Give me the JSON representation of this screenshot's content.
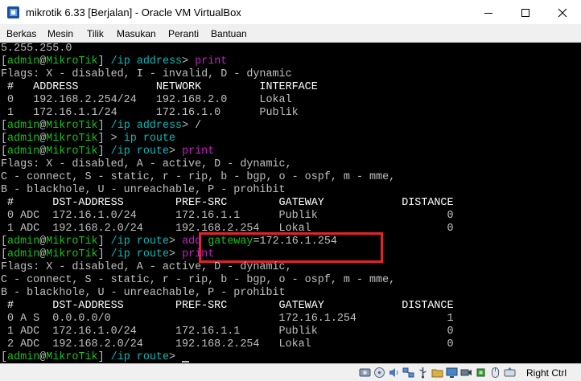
{
  "window": {
    "title": "mikrotik 6.33 [Berjalan] - Oracle VM VirtualBox",
    "icons": [
      "virtualbox-icon",
      "minimize-icon",
      "maximize-icon",
      "close-icon"
    ]
  },
  "menu": {
    "items": [
      "Berkas",
      "Mesin",
      "Tilik",
      "Masukan",
      "Peranti",
      "Bantuan"
    ]
  },
  "terminal": {
    "colors": {
      "background": "#000000",
      "default": "#c0c0c0",
      "green": "#19c219",
      "teal": "#0bb8b8",
      "purple": "#c020c0",
      "highlight_box": "#e0242a"
    },
    "lines": [
      [
        [
          "5.255.255.0",
          "d"
        ]
      ],
      [
        [
          "[",
          "d"
        ],
        [
          "admin",
          "g"
        ],
        [
          "@",
          "d"
        ],
        [
          "MikroTik",
          "g"
        ],
        [
          "] ",
          "d"
        ],
        [
          "/ip address",
          "t"
        ],
        [
          "> ",
          "d"
        ],
        [
          "print",
          "p"
        ]
      ],
      [
        [
          "Flags: X - disabled, I - invalid, D - dynamic",
          "d"
        ]
      ],
      [
        [
          " #   ADDRESS            NETWORK         INTERFACE",
          "w"
        ]
      ],
      [
        [
          " 0   192.168.2.254/24   192.168.2.0     Lokal",
          "d"
        ]
      ],
      [
        [
          " 1   172.16.1.1/24      172.16.1.0      Publik",
          "d"
        ]
      ],
      [
        [
          "[",
          "d"
        ],
        [
          "admin",
          "g"
        ],
        [
          "@",
          "d"
        ],
        [
          "MikroTik",
          "g"
        ],
        [
          "] ",
          "d"
        ],
        [
          "/ip address",
          "t"
        ],
        [
          "> /",
          "d"
        ]
      ],
      [
        [
          "[",
          "d"
        ],
        [
          "admin",
          "g"
        ],
        [
          "@",
          "d"
        ],
        [
          "MikroTik",
          "g"
        ],
        [
          "] > ",
          "d"
        ],
        [
          "ip route",
          "t"
        ]
      ],
      [
        [
          "[",
          "d"
        ],
        [
          "admin",
          "g"
        ],
        [
          "@",
          "d"
        ],
        [
          "MikroTik",
          "g"
        ],
        [
          "] ",
          "d"
        ],
        [
          "/ip route",
          "t"
        ],
        [
          "> ",
          "d"
        ],
        [
          "print",
          "p"
        ]
      ],
      [
        [
          "Flags: X - disabled, A - active, D - dynamic,",
          "d"
        ]
      ],
      [
        [
          "C - connect, S - static, r - rip, b - bgp, o - ospf, m - mme,",
          "d"
        ]
      ],
      [
        [
          "B - blackhole, U - unreachable, P - prohibit",
          "d"
        ]
      ],
      [
        [
          " #      DST-ADDRESS        PREF-SRC        GATEWAY            DISTANCE",
          "w"
        ]
      ],
      [
        [
          " 0 ADC  172.16.1.0/24      172.16.1.1      Publik                    0",
          "d"
        ]
      ],
      [
        [
          " 1 ADC  192.168.2.0/24     192.168.2.254   Lokal                     0",
          "d"
        ]
      ],
      [
        [
          "[",
          "d"
        ],
        [
          "admin",
          "g"
        ],
        [
          "@",
          "d"
        ],
        [
          "MikroTik",
          "g"
        ],
        [
          "] ",
          "d"
        ],
        [
          "/ip route",
          "t"
        ],
        [
          "> ",
          "d"
        ],
        [
          "add ",
          "p"
        ],
        [
          "gateway",
          "g"
        ],
        [
          "=",
          "d"
        ],
        [
          "172.16.1.254",
          "d"
        ]
      ],
      [
        [
          "[",
          "d"
        ],
        [
          "admin",
          "g"
        ],
        [
          "@",
          "d"
        ],
        [
          "MikroTik",
          "g"
        ],
        [
          "] ",
          "d"
        ],
        [
          "/ip route",
          "t"
        ],
        [
          "> ",
          "d"
        ],
        [
          "print",
          "p"
        ]
      ],
      [
        [
          "Flags: X - disabled, A - active, D - dynamic,",
          "d"
        ]
      ],
      [
        [
          "C - connect, S - static, r - rip, b - bgp, o - ospf, m - mme,",
          "d"
        ]
      ],
      [
        [
          "B - blackhole, U - unreachable, P - prohibit",
          "d"
        ]
      ],
      [
        [
          " #      DST-ADDRESS        PREF-SRC        GATEWAY            DISTANCE",
          "w"
        ]
      ],
      [
        [
          " 0 A S  0.0.0.0/0                          172.16.1.254              1",
          "d"
        ]
      ],
      [
        [
          " 1 ADC  172.16.1.0/24      172.16.1.1      Publik                    0",
          "d"
        ]
      ],
      [
        [
          " 2 ADC  192.168.2.0/24     192.168.2.254   Lokal                     0",
          "d"
        ]
      ],
      [
        [
          "[",
          "d"
        ],
        [
          "admin",
          "g"
        ],
        [
          "@",
          "d"
        ],
        [
          "MikroTik",
          "g"
        ],
        [
          "] ",
          "d"
        ],
        [
          "/ip route",
          "t"
        ],
        [
          "> ",
          "d"
        ]
      ]
    ]
  },
  "statusbar": {
    "icons": [
      "hard-disk-icon",
      "optical-drive-icon",
      "audio-icon",
      "network-icon",
      "usb-icon",
      "shared-folders-icon",
      "display-icon",
      "video-capture-icon",
      "cpu-icon",
      "mouse-integration-icon",
      "keyboard-arrow-icon"
    ],
    "host_key": "Right Ctrl"
  }
}
